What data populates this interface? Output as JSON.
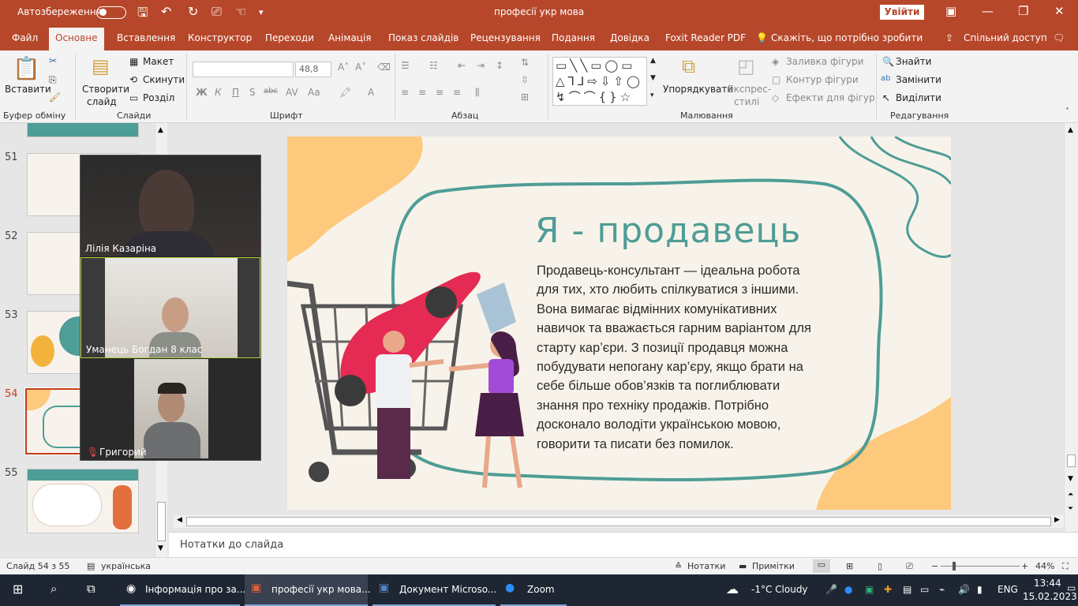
{
  "titlebar": {
    "autosave_label": "Автозбереження",
    "doc_title": "професії укр мова",
    "signin_label": "Увійти"
  },
  "ribbon_tabs": [
    "Файл",
    "Основне",
    "Вставлення",
    "Конструктор",
    "Переходи",
    "Анімація",
    "Показ слайдів",
    "Рецензування",
    "Подання",
    "Довідка",
    "Foxit Reader PDF"
  ],
  "active_tab": "Основне",
  "tell_me": "Скажіть, що потрібно зробити",
  "share_label": "Спільний доступ",
  "ribbon": {
    "groups": {
      "clipboard": "Буфер обміну",
      "slides": "Слайди",
      "font": "Шрифт",
      "paragraph": "Абзац",
      "drawing": "Малювання",
      "editing": "Редагування"
    },
    "paste_label": "Вставити",
    "new_slide_label": "Створити",
    "new_slide_label2": "слайд",
    "layout_label": "Макет",
    "reset_label": "Скинути",
    "section_label": "Розділ",
    "font_size": "48,8",
    "bold": "Ж",
    "italic": "К",
    "underline": "П",
    "strike": "S",
    "char_spacing": "abc",
    "arrange_label": "Упорядкувати",
    "quick_styles_label": "Експрес-",
    "quick_styles_label2": "стилі",
    "shape_fill": "Заливка фігури",
    "shape_outline": "Контур фігури",
    "shape_effects": "Ефекти для фігур",
    "find_label": "Знайти",
    "replace_label": "Замінити",
    "select_label": "Виділити"
  },
  "thumbnails": [
    {
      "num": "51"
    },
    {
      "num": "52"
    },
    {
      "num": "53"
    },
    {
      "num": "54",
      "selected": true
    },
    {
      "num": "55"
    }
  ],
  "video_participants": [
    {
      "name": "Лілія Казаріна"
    },
    {
      "name": "Уманець Богдан 8 клас"
    },
    {
      "name": "Григорий"
    }
  ],
  "slide": {
    "title": "Я - продавець",
    "body_lines": [
      "Продавець-консультант — ідеальна робота",
      "для тих, хто любить спілкуватися з іншими.",
      "Вона вимагає відмінних комунікативних",
      "навичок та вважається гарним варіантом для",
      "старту кар’єри. З позиції продавця можна",
      "побудувати непогану кар’єру, якщо брати на",
      "себе більше обов’язків та поглиблювати",
      "знання про техніку продажів. Потрібно",
      "досконало володіти українською мовою,",
      "говорити та писати без помилок."
    ]
  },
  "notes_placeholder": "Нотатки до слайда",
  "status": {
    "slide_counter": "Слайд 54 з 55",
    "language": "українська",
    "notes_btn": "Нотатки",
    "comments_btn": "Примітки",
    "zoom": "44%"
  },
  "taskbar": {
    "apps": [
      {
        "label": "Інформація про за..."
      },
      {
        "label": "професії укр мова..."
      },
      {
        "label": "Документ Microso..."
      },
      {
        "label": "Zoom"
      }
    ],
    "weather": "-1°C  Cloudy",
    "lang": "ENG",
    "time": "13:44",
    "date": "15.02.2023"
  },
  "colors": {
    "accent": "#b7472a",
    "teal": "#4e9d96",
    "peach": "#fdc97c"
  }
}
